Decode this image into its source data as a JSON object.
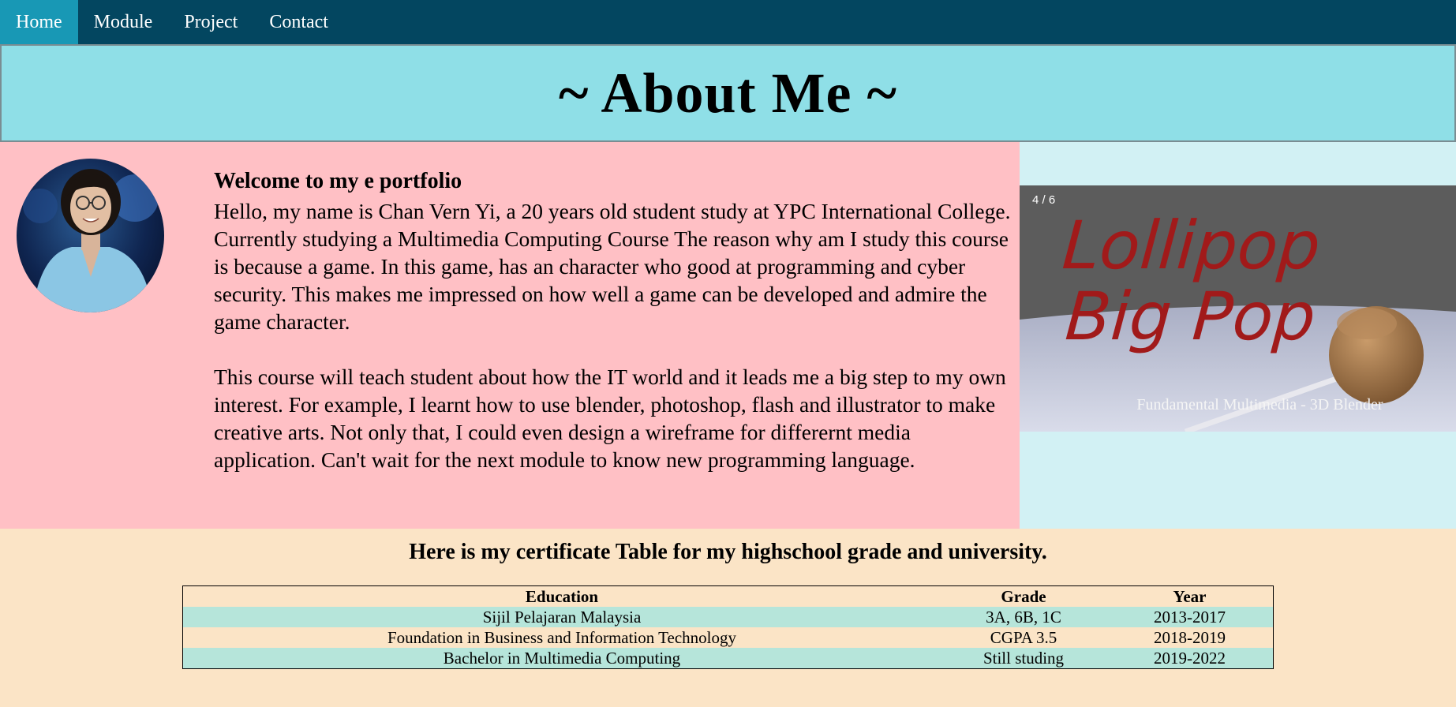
{
  "nav": {
    "items": [
      {
        "label": "Home",
        "active": true
      },
      {
        "label": "Module",
        "active": false
      },
      {
        "label": "Project",
        "active": false
      },
      {
        "label": "Contact",
        "active": false
      }
    ]
  },
  "header": {
    "title": "~ About Me ~"
  },
  "about": {
    "heading": "Welcome to my e portfolio",
    "paragraphs": [
      "Hello, my name is Chan Vern Yi, a 20 years old student study at YPC International College. Currently studying a Multimedia Computing Course The reason why am I study this course is because a game. In this game, has an character who good at programming and cyber security. This makes me impressed on how well a game can be developed and admire the game character.",
      "This course will teach student about how the IT world and it leads me a big step to my own interest. For example, I learnt how to use blender, photoshop, flash and illustrator to make creative arts. Not only that, I could even design a wireframe for differernt media application. Can't wait for the next module to know new programming language."
    ]
  },
  "slideshow": {
    "counter": "4 / 6",
    "image_text_line1": "Lollipop",
    "image_text_line2": "Big Pop",
    "caption": "Fundamental Multimedia - 3D Blender"
  },
  "certificates": {
    "heading": "Here is my certificate Table for my highschool grade and university.",
    "columns": [
      "Education",
      "Grade",
      "Year"
    ],
    "rows": [
      [
        "Sijil Pelajaran Malaysia",
        "3A, 6B, 1C",
        "2013-2017"
      ],
      [
        "Foundation in Business and Information Technology",
        "CGPA 3.5",
        "2018-2019"
      ],
      [
        "Bachelor in Multimedia Computing",
        "Still studing",
        "2019-2022"
      ]
    ]
  },
  "colors": {
    "nav_bg": "#034660",
    "nav_active": "#1898b5",
    "header_bg": "#8fdfe7",
    "about_bg": "#ffc0c5",
    "slider_bg": "#d2f1f4",
    "page_bg": "#fbe4c6",
    "table_alt_row": "#b6e5da",
    "lollipop_text": "#a11a1a"
  }
}
